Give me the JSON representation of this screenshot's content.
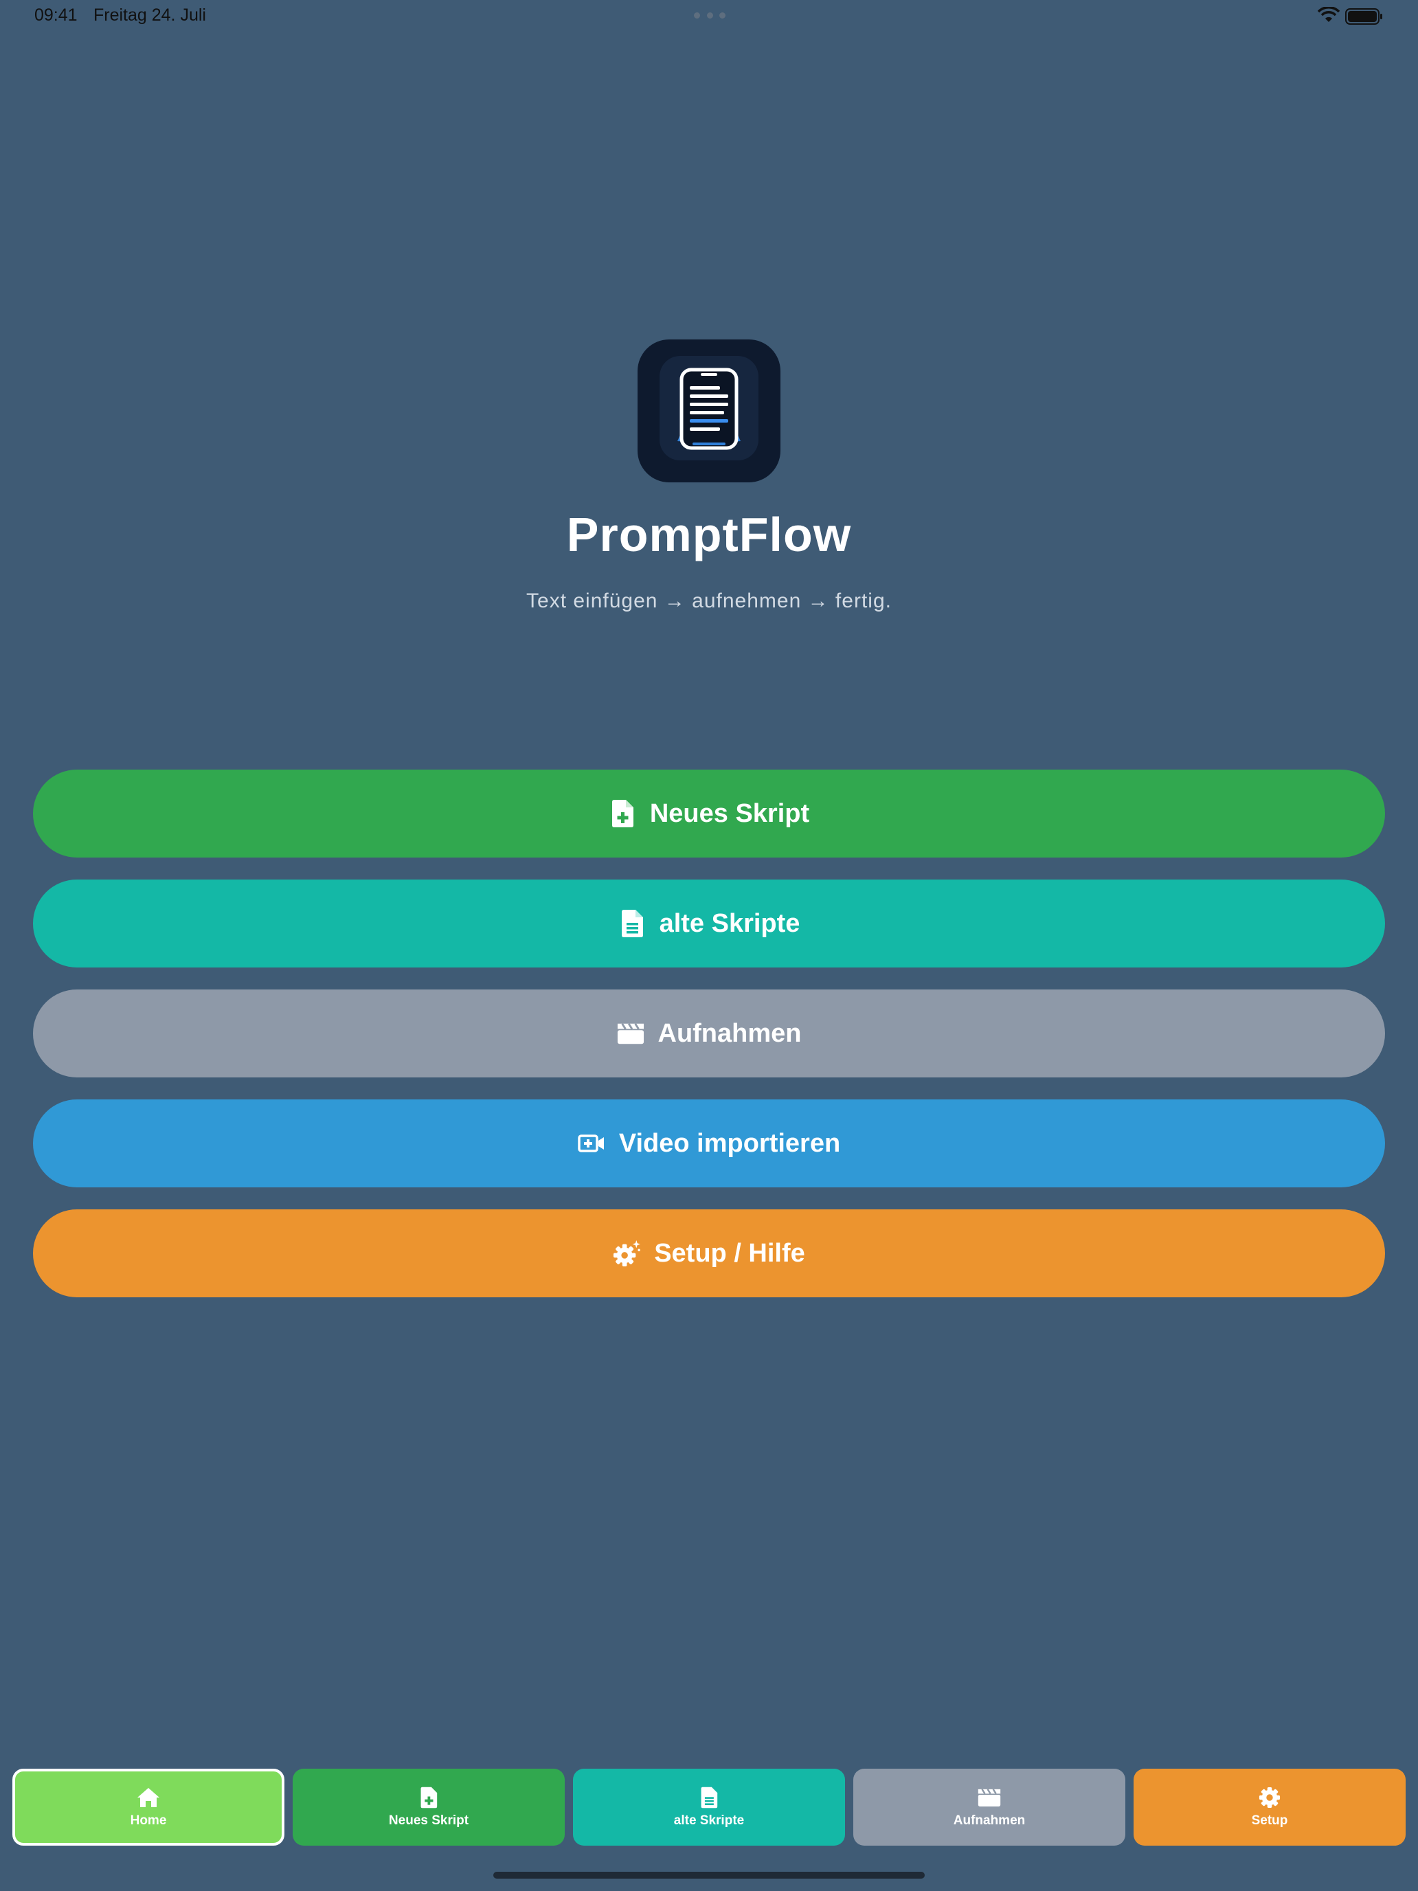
{
  "status_bar": {
    "time": "09:41",
    "date": "Freitag 24. Juli"
  },
  "header": {
    "app_name": "PromptFlow",
    "tagline": "Text einfügen → aufnehmen → fertig."
  },
  "menu": [
    {
      "label": "Neues Skript",
      "icon": "document-plus-icon",
      "color": "#31a84f"
    },
    {
      "label": "alte Skripte",
      "icon": "document-lines-icon",
      "color": "#14b8a6"
    },
    {
      "label": "Aufnahmen",
      "icon": "clapperboard-icon",
      "color": "#8e99a8"
    },
    {
      "label": "Video importieren",
      "icon": "video-plus-icon",
      "color": "#3099d6"
    },
    {
      "label": "Setup / Hilfe",
      "icon": "gear-sparkle-icon",
      "color": "#ec942f"
    }
  ],
  "tabs": [
    {
      "label": "Home",
      "icon": "house-icon",
      "color": "#7fdb5b",
      "selected": true
    },
    {
      "label": "Neues Skript",
      "icon": "document-plus-icon",
      "color": "#31a84f"
    },
    {
      "label": "alte Skripte",
      "icon": "document-lines-icon",
      "color": "#14b8a6"
    },
    {
      "label": "Aufnahmen",
      "icon": "clapperboard-icon",
      "color": "#8e99a8"
    },
    {
      "label": "Setup",
      "icon": "gear-icon",
      "color": "#ec942f"
    }
  ],
  "colors": {
    "background": "#3f5b75"
  }
}
